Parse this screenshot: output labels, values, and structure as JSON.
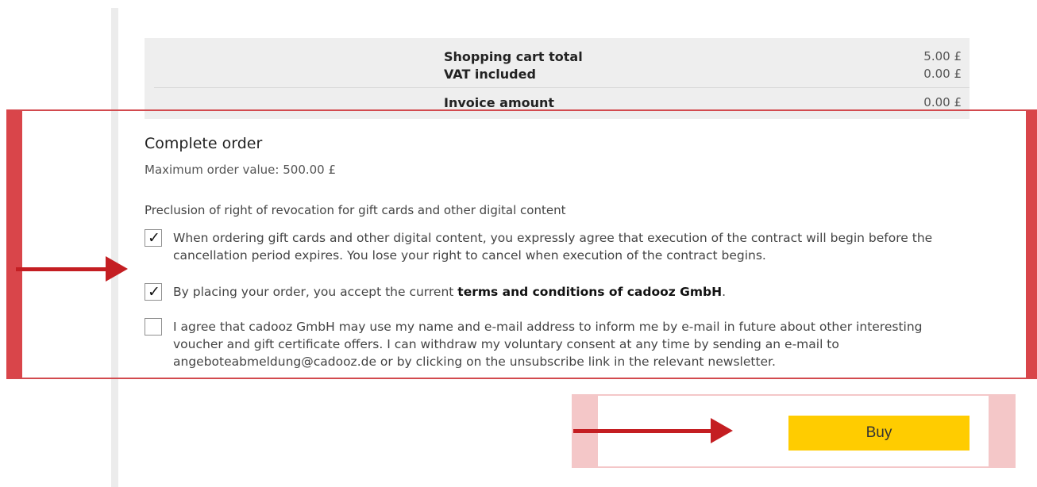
{
  "totals": {
    "cart_total_label": "Shopping cart total",
    "cart_total_value": "5.00 £",
    "vat_label": "VAT included",
    "vat_value": "0.00 £",
    "invoice_label": "Invoice amount",
    "invoice_value": "0.00 £"
  },
  "order": {
    "title": "Complete order",
    "max_value_text": "Maximum order value: 500.00 £",
    "preclusion_title": "Preclusion of right of revocation for gift cards and other digital content",
    "checkboxes": [
      {
        "checked": true,
        "text": "When ordering gift cards and other digital content, you expressly agree that execution of the contract will begin before the cancellation period expires. You lose your right to cancel when execution of the contract begins."
      },
      {
        "checked": true,
        "text_before": "By placing your order, you accept the current ",
        "link_text": "terms and conditions of cadooz GmbH",
        "text_after": "."
      },
      {
        "checked": false,
        "text": "I agree that cadooz GmbH may use my name and e-mail address to inform me by e-mail in future about other interesting voucher and gift certificate offers. I can withdraw my voluntary consent at any time by sending an e-mail to angeboteabmeldung@cadooz.de or by clicking on the unsubscribe link in the relevant newsletter."
      }
    ],
    "check_glyph": "✓"
  },
  "buy": {
    "label": "Buy"
  },
  "colors": {
    "highlight_red": "#d9454a",
    "arrow_red": "#c41e22",
    "buy_yellow": "#ffcc00",
    "buy_frame_pink": "#f4c7c8"
  },
  "icons": [
    "arrow-right-icon",
    "checkmark-icon"
  ]
}
